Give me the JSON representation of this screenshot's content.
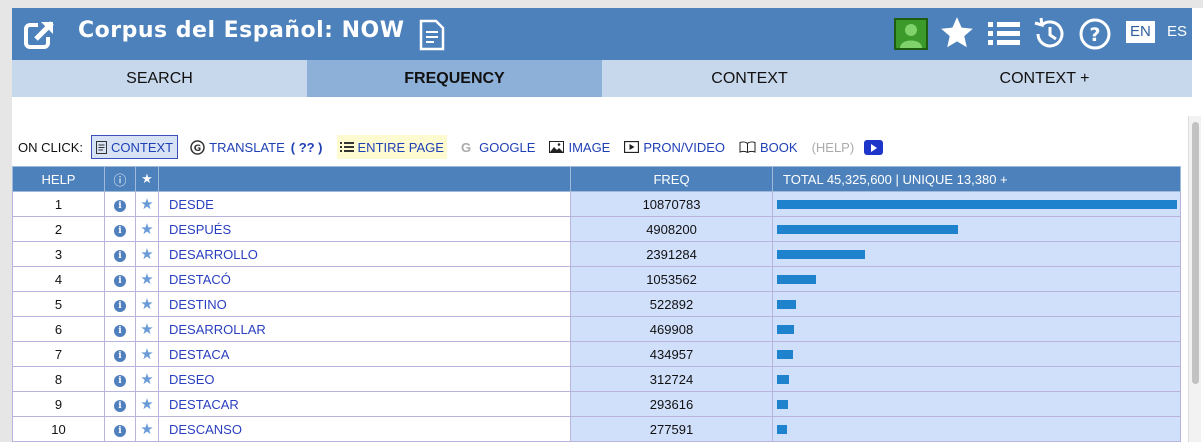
{
  "header": {
    "title": "Corpus del Español: NOW",
    "lang_en": "EN",
    "lang_es": "ES",
    "icons": [
      "external-link-icon",
      "document-icon",
      "user-icon",
      "star-icon",
      "list-icon",
      "history-icon",
      "help-icon"
    ],
    "colors": {
      "header_bg": "#4d81bb",
      "user_bg": "#3c9a2a"
    }
  },
  "tabs": [
    {
      "label": "SEARCH",
      "active": false
    },
    {
      "label": "FREQUENCY",
      "active": true
    },
    {
      "label": "CONTEXT",
      "active": false
    },
    {
      "label": "CONTEXT +",
      "active": false
    }
  ],
  "onclick": {
    "label": "ON CLICK:",
    "context": "CONTEXT",
    "translate": "TRANSLATE",
    "translate_q": "( ?? )",
    "entire_page": "ENTIRE PAGE",
    "google": "GOOGLE",
    "image": "IMAGE",
    "pron_video": "PRON/VIDEO",
    "book": "BOOK",
    "help": "(HELP)"
  },
  "table": {
    "headers": {
      "help": "HELP",
      "info": "ⓘ",
      "star": "★",
      "freq": "FREQ",
      "total": "TOTAL 45,325,600 | UNIQUE 13,380 +"
    },
    "rows": [
      {
        "num": "1",
        "word": "DESDE",
        "freq": "10870783"
      },
      {
        "num": "2",
        "word": "DESPUÉS",
        "freq": "4908200"
      },
      {
        "num": "3",
        "word": "DESARROLLO",
        "freq": "2391284"
      },
      {
        "num": "4",
        "word": "DESTACÓ",
        "freq": "1053562"
      },
      {
        "num": "5",
        "word": "DESTINO",
        "freq": "522892"
      },
      {
        "num": "6",
        "word": "DESARROLLAR",
        "freq": "469908"
      },
      {
        "num": "7",
        "word": "DESTACA",
        "freq": "434957"
      },
      {
        "num": "8",
        "word": "DESEO",
        "freq": "312724"
      },
      {
        "num": "9",
        "word": "DESTACAR",
        "freq": "293616"
      },
      {
        "num": "10",
        "word": "DESCANSO",
        "freq": "277591"
      }
    ]
  }
}
